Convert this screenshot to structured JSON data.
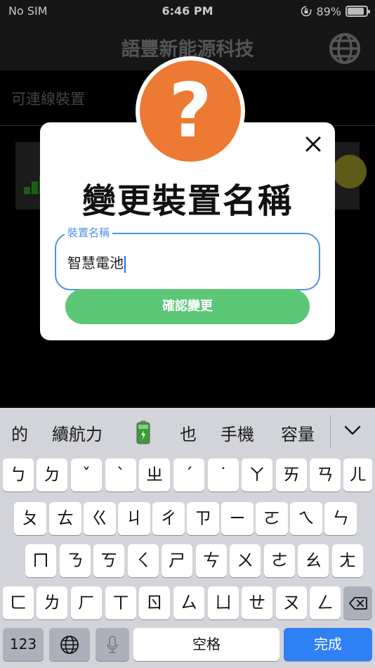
{
  "status_bar": {
    "carrier": "No SIM",
    "time": "6:46 PM",
    "battery_percent": "89%",
    "battery_level": 0.89
  },
  "nav": {
    "title": "語豐新能源科技",
    "globe_icon": "globe-icon"
  },
  "background": {
    "section_label": "可連線裝置"
  },
  "dialog": {
    "help_icon_glyph": "?",
    "title": "變更裝置名稱",
    "field_label": "裝置名稱",
    "field_value": "智慧電池",
    "confirm_label": "確認變更",
    "colors": {
      "accent_orange": "#ec7a32",
      "field_blue": "#4e93e6",
      "confirm_green": "#5cc776"
    }
  },
  "keyboard": {
    "candidates": [
      "的",
      "續航力",
      "也",
      "手機",
      "容量"
    ],
    "candidate_emoji": "battery-emoji-icon",
    "rows": [
      [
        "ㄅ",
        "ㄉ",
        "ˇ",
        "ˋ",
        "ㄓ",
        "ˊ",
        "˙",
        "ㄚ",
        "ㄞ",
        "ㄢ",
        "ㄦ"
      ],
      [
        "ㄆ",
        "ㄊ",
        "ㄍ",
        "ㄐ",
        "ㄔ",
        "ㄗ",
        "ㄧ",
        "ㄛ",
        "ㄟ",
        "ㄣ"
      ],
      [
        "ㄇ",
        "ㄋ",
        "ㄎ",
        "ㄑ",
        "ㄕ",
        "ㄘ",
        "ㄨ",
        "ㄜ",
        "ㄠ",
        "ㄤ"
      ],
      [
        "ㄈ",
        "ㄌ",
        "ㄏ",
        "ㄒ",
        "ㄖ",
        "ㄙ",
        "ㄩ",
        "ㄝ",
        "ㄡ",
        "ㄥ"
      ]
    ],
    "numbers_key": "123",
    "space_key": "空格",
    "done_key": "完成"
  }
}
